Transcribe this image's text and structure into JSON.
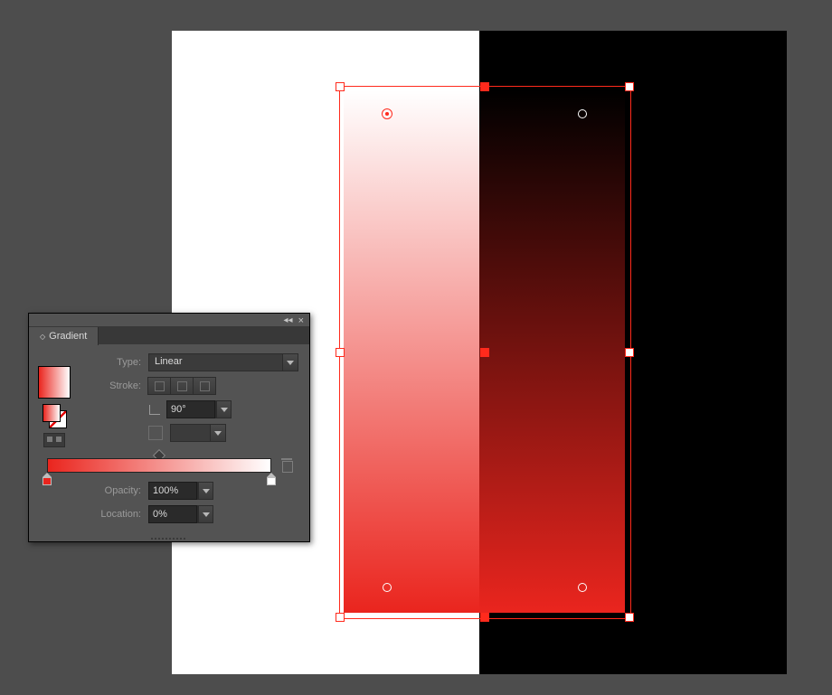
{
  "panel": {
    "title": "Gradient",
    "type_label": "Type:",
    "type_value": "Linear",
    "stroke_label": "Stroke:",
    "angle_value": "90°",
    "opacity_label": "Opacity:",
    "opacity_value": "100%",
    "location_label": "Location:",
    "location_value": "0%"
  },
  "gradient": {
    "angle": 90,
    "stops": [
      {
        "color": "#ea251e",
        "location": 0,
        "opacity": 100
      },
      {
        "color": "#ffffff",
        "location": 100,
        "opacity": 100
      }
    ]
  }
}
